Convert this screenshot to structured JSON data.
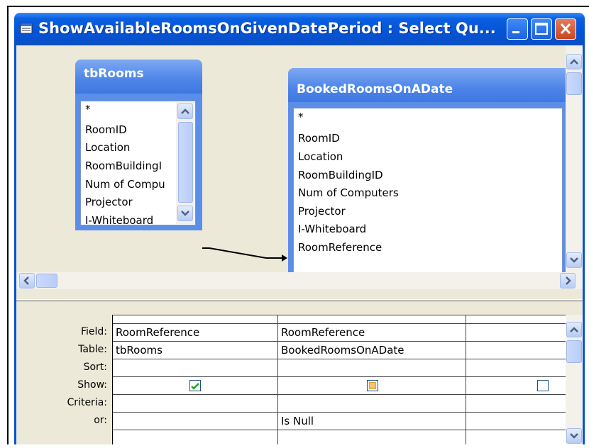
{
  "window": {
    "title": "ShowAvailableRoomsOnGivenDatePeriod : Select Qu...",
    "title_color": "#0454d6"
  },
  "tables": [
    {
      "name": "tbRooms",
      "fields": [
        "*",
        "RoomID",
        "Location",
        "RoomBuildingI",
        "Num of Compu",
        "Projector",
        "I-Whiteboard"
      ]
    },
    {
      "name": "BookedRoomsOnADate",
      "fields": [
        "*",
        "RoomID",
        "Location",
        "RoomBuildingID",
        "Num of Computers",
        "Projector",
        "I-Whiteboard",
        "RoomReference"
      ]
    }
  ],
  "grid": {
    "row_labels": [
      "Field:",
      "Table:",
      "Sort:",
      "Show:",
      "Criteria:",
      "or:"
    ],
    "columns": [
      {
        "field": "RoomReference",
        "table": "tbRooms",
        "sort": "",
        "show": true,
        "criteria": "",
        "or": ""
      },
      {
        "field": "RoomReference",
        "table": "BookedRoomsOnADate",
        "sort": "",
        "show": false,
        "criteria": "Is Null",
        "or": ""
      },
      {
        "field": "",
        "table": "",
        "sort": "",
        "show": false,
        "criteria": "",
        "or": ""
      }
    ]
  },
  "icons": {
    "minimize": "minimize-icon",
    "maximize": "maximize-icon",
    "close": "close-icon"
  }
}
